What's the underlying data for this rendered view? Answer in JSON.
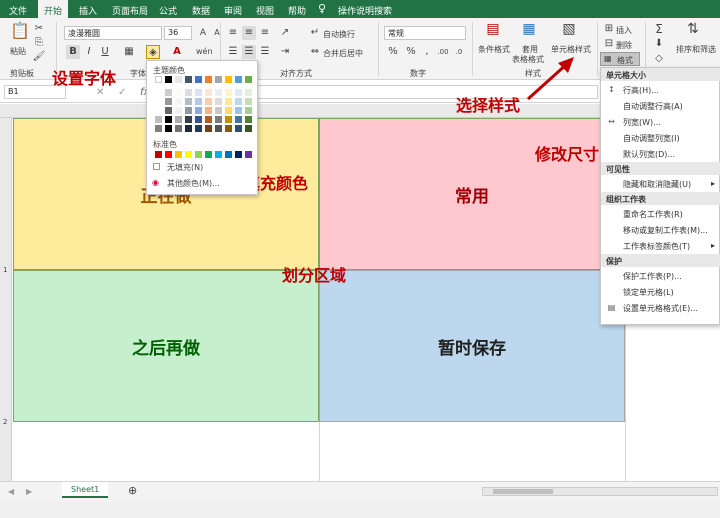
{
  "tabs": [
    "文件",
    "开始",
    "插入",
    "页面布局",
    "公式",
    "数据",
    "审阅",
    "视图",
    "帮助",
    "操作说明搜索"
  ],
  "ribbon": {
    "paste": "粘贴",
    "clipboard": "剪贴板",
    "font_name": "凌漫雅圆",
    "font_size": "36",
    "font_group": "字体",
    "wrap": "自动换行",
    "merge": "合并后居中",
    "align_group": "对齐方式",
    "number_format": "常规",
    "number_group": "数字",
    "cond_format": "条件格式",
    "table_format_1": "套用",
    "table_format_2": "表格格式",
    "cell_style": "单元格样式",
    "style_group": "样式",
    "insert": "插入",
    "delete": "删除",
    "format": "格式",
    "sort": "排序和筛选"
  },
  "namebox": "B1",
  "formula_labels": {
    "cancel": "✕",
    "enter": "✓",
    "fx": "fx"
  },
  "grid": {
    "cells": [
      {
        "text": "正在做",
        "color": "#9c5a00",
        "bg": "#ffeb9c"
      },
      {
        "text": "常用",
        "color": "#9c0006",
        "bg": "#ffc7ce"
      },
      {
        "text": "之后再做",
        "color": "#006100",
        "bg": "#c6efce"
      },
      {
        "text": "暂时保存",
        "color": "#1f1f1f",
        "bg": "#bdd7ee"
      }
    ],
    "row_labels": [
      "1",
      "2"
    ]
  },
  "annotations": {
    "font": "设置字体",
    "fill": "填充颜色",
    "split": "划分区域",
    "style": "选择样式",
    "size": "修改尺寸"
  },
  "color_popup": {
    "theme_title": "主题颜色",
    "std_title": "标准色",
    "no_fill": "无填充(N)",
    "more": "其他颜色(M)...",
    "theme_top": [
      "#ffffff",
      "#000000",
      "#e7e6e6",
      "#44546a",
      "#4472c4",
      "#ed7d31",
      "#a5a5a5",
      "#ffc000",
      "#5b9bd5",
      "#70ad47"
    ],
    "standard": [
      "#c00000",
      "#ff0000",
      "#ffc000",
      "#ffff00",
      "#92d050",
      "#00b050",
      "#00b0f0",
      "#0070c0",
      "#002060",
      "#7030a0"
    ]
  },
  "format_menu": {
    "sections": [
      {
        "title": "单元格大小",
        "items": [
          "行高(H)...",
          "自动调整行高(A)",
          "列宽(W)...",
          "自动调整列宽(I)",
          "默认列宽(D)..."
        ]
      },
      {
        "title": "可见性",
        "items": [
          "隐藏和取消隐藏(U)"
        ]
      },
      {
        "title": "组织工作表",
        "items": [
          "重命名工作表(R)",
          "移动或复制工作表(M)...",
          "工作表标签颜色(T)"
        ]
      },
      {
        "title": "保护",
        "items": [
          "保护工作表(P)...",
          "锁定单元格(L)",
          "设置单元格格式(E)..."
        ]
      }
    ]
  },
  "sheet_tab": "Sheet1",
  "add_sheet": "⊕"
}
